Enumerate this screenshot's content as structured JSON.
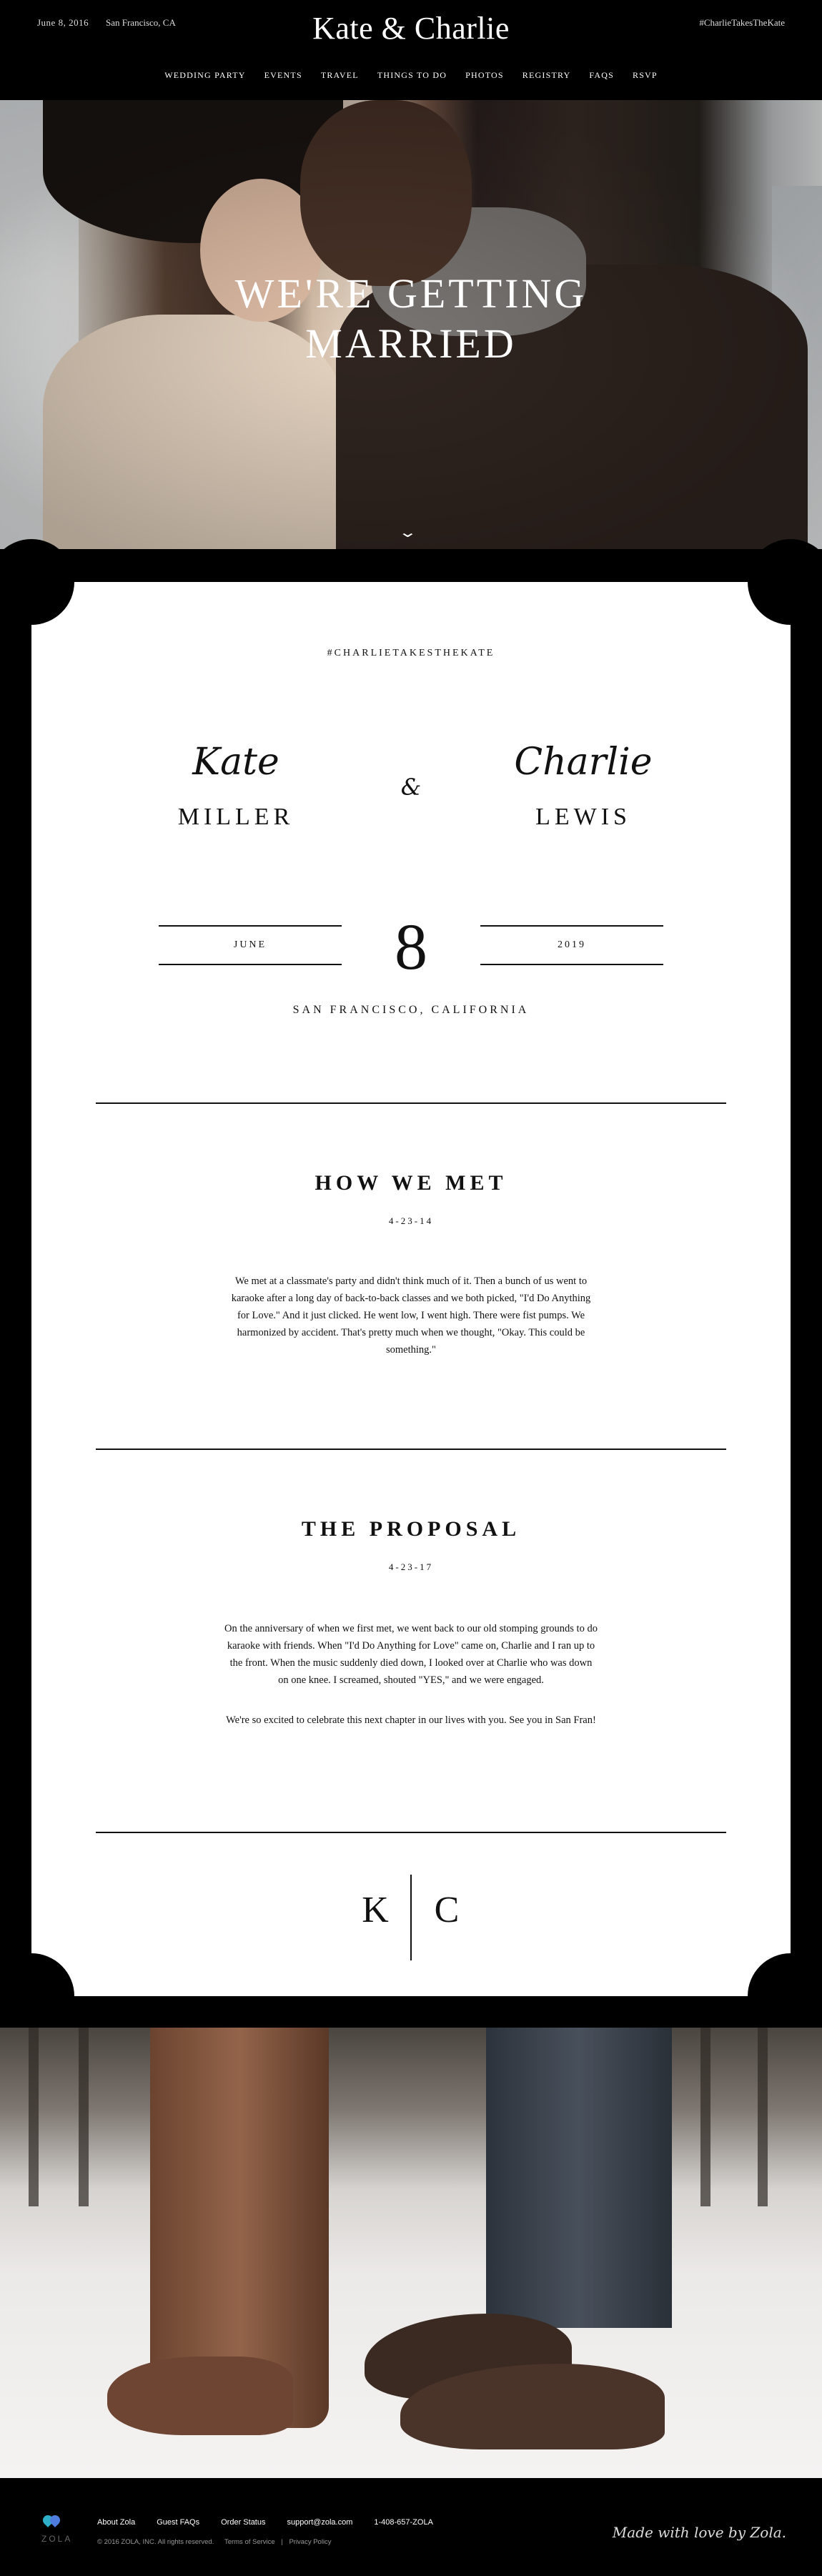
{
  "header": {
    "date": "June 8, 2016",
    "location": "San Francisco, CA",
    "title": "Kate & Charlie",
    "hashtag": "#CharlieTakesTheKate",
    "nav": [
      "WEDDING PARTY",
      "EVENTS",
      "TRAVEL",
      "THINGS TO DO",
      "PHOTOS",
      "REGISTRY",
      "FAQS",
      "RSVP"
    ]
  },
  "hero": {
    "title_line1": "WE'RE GETTING",
    "title_line2": "MARRIED",
    "scroll_icon": "chevron-down-icon"
  },
  "card": {
    "hashtag": "#CHARLIETAKESTHEKATE",
    "bride_first": "Kate",
    "bride_last": "MILLER",
    "amp": "&",
    "groom_first": "Charlie",
    "groom_last": "LEWIS",
    "month": "JUNE",
    "day": "8",
    "year": "2019",
    "venue": "SAN FRANCISCO, CALIFORNIA",
    "how_we_met": {
      "title": "HOW WE MET",
      "date": "4-23-14",
      "body": "We met at a classmate's party and didn't think much of it. Then a bunch of us went to karaoke after a long day of back-to-back classes and we both picked, \"I'd Do Anything for Love.\" And it just clicked. He went low, I went high. There were fist pumps. We harmonized by accident. That's pretty much when we thought, \"Okay. This could be something.\""
    },
    "proposal": {
      "title": "THE PROPOSAL",
      "date": "4-23-17",
      "body": "On the anniversary of when we first met, we went back to our old stomping grounds to do karaoke with friends. When \"I'd Do Anything for Love\" came on, Charlie and I ran up to the front. When the music suddenly died down, I looked over at Charlie who was down on one knee. I screamed, shouted \"YES,\" and we were engaged.",
      "body2": "We're so excited to celebrate this next chapter in our lives with you. See you in San Fran!"
    },
    "monogram_left": "K",
    "monogram_right": "C"
  },
  "footer": {
    "brand": "ZOLA",
    "links": [
      "About Zola",
      "Guest FAQs",
      "Order Status",
      "support@zola.com",
      "1-408-657-ZOLA"
    ],
    "copyright": "© 2016 ZOLA, INC.  All rights reserved.",
    "terms": "Terms of Service",
    "privacy": "Privacy Policy",
    "made_with_love": "Made with love by Zola."
  },
  "colors": {
    "background": "#000000",
    "card": "#ffffff",
    "text": "#111111",
    "zola_teal": "#2fb0c8",
    "zola_blue": "#4f7ddf"
  }
}
